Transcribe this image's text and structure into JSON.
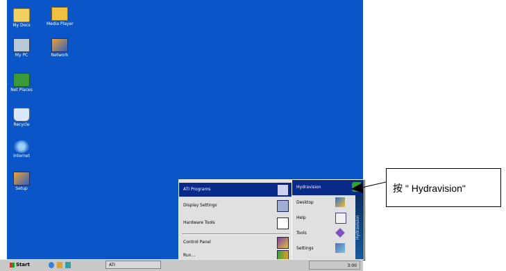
{
  "desktop": {
    "icons": [
      {
        "label": "My Docs",
        "icon": "folder-icon"
      },
      {
        "label": "Media Player",
        "icon": "media-icon"
      },
      {
        "label": "My PC",
        "icon": "computer-icon"
      },
      {
        "label": "Network",
        "icon": "app-icon"
      },
      {
        "label": "Net Places",
        "icon": "network-icon"
      },
      {
        "label": "Recycle",
        "icon": "recycle-bin-icon"
      },
      {
        "label": "Internet",
        "icon": "internet-explorer-icon"
      },
      {
        "label": "Setup",
        "icon": "setup-icon"
      }
    ]
  },
  "start_menu": {
    "items": [
      {
        "label": "ATI Programs"
      },
      {
        "label": "Display Settings"
      },
      {
        "label": "Hardware Tools"
      },
      {
        "label": "Control Panel"
      },
      {
        "label": "Run..."
      }
    ]
  },
  "submenu": {
    "items": [
      {
        "label": "Hydravision"
      },
      {
        "label": "Desktop"
      },
      {
        "label": "Help"
      },
      {
        "label": "Tools"
      },
      {
        "label": "Settings"
      }
    ],
    "strip_label": "Hydravision"
  },
  "taskbar": {
    "start_label": "Start",
    "task_label": "ATI",
    "clock": "3:00"
  },
  "callout": {
    "text": "按 \" Hydravision\""
  },
  "colors": {
    "desktop": "#0a56c8",
    "highlight": "#0a2a8a"
  }
}
